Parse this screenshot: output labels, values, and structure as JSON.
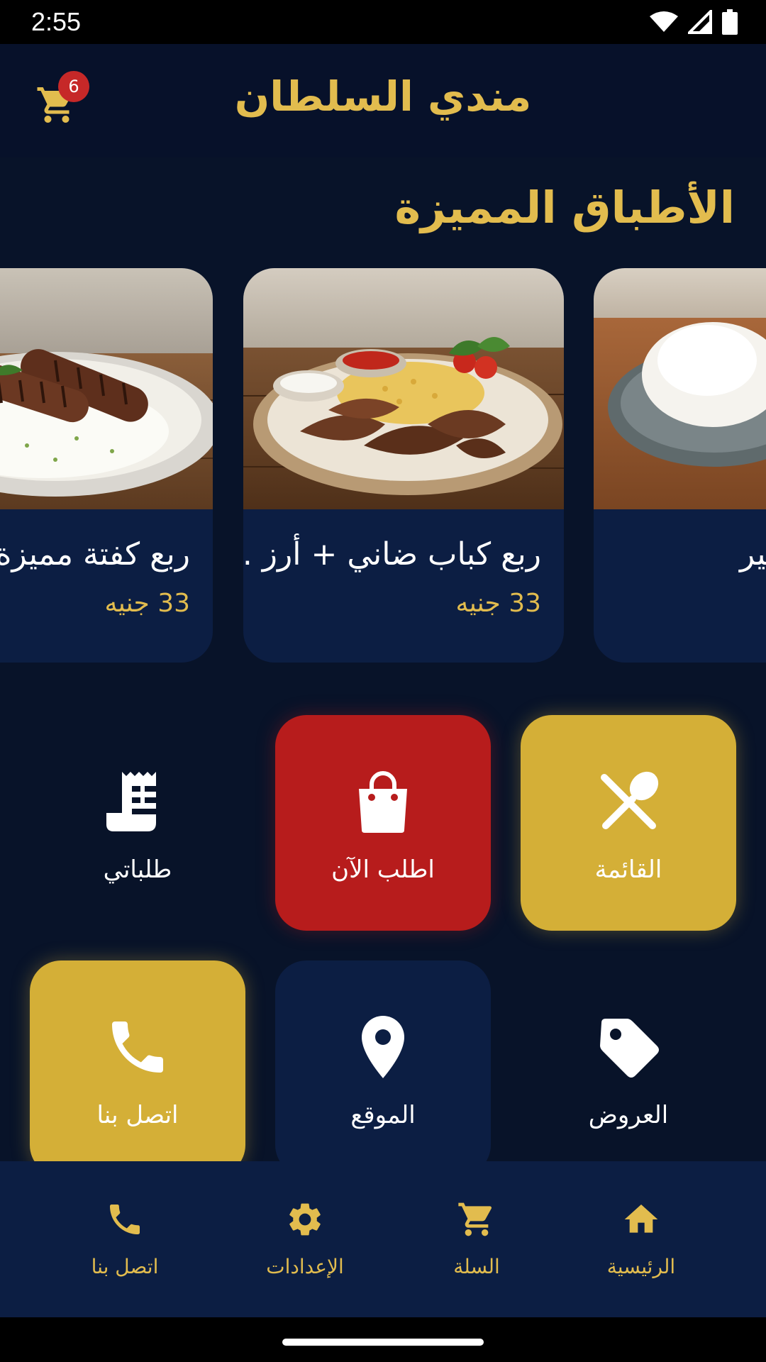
{
  "status_bar": {
    "time": "2:55"
  },
  "app_bar": {
    "title": "مندي السلطان",
    "cart_count": "6"
  },
  "featured": {
    "title": "الأطباق المميزة",
    "dishes": [
      {
        "name": "ربع كفتة مميزة",
        "price": "33 جنيه"
      },
      {
        "name": "ربع كباب ضاني + أرز ...",
        "price": "33 جنيه"
      },
      {
        "name": "بير",
        "price": ""
      }
    ]
  },
  "tiles": {
    "menu": "القائمة",
    "order_now": "اطلب الآن",
    "my_orders": "طلباتي",
    "offers": "العروض",
    "location": "الموقع",
    "contact": "اتصل بنا"
  },
  "bottom_nav": {
    "home": "الرئيسية",
    "cart": "السلة",
    "settings": "الإعدادات",
    "contact": "اتصل بنا"
  },
  "colors": {
    "background": "#081329",
    "card": "#0c1e43",
    "gold": "#d4af37",
    "red": "#b71c1c",
    "accent_text": "#e2bc4e"
  },
  "icons": [
    "wifi-icon",
    "signal-icon",
    "battery-icon",
    "cart-icon",
    "receipt-icon",
    "shopping-bag-icon",
    "utensils-icon",
    "phone-icon",
    "location-pin-icon",
    "tag-icon",
    "home-icon",
    "gear-icon"
  ]
}
